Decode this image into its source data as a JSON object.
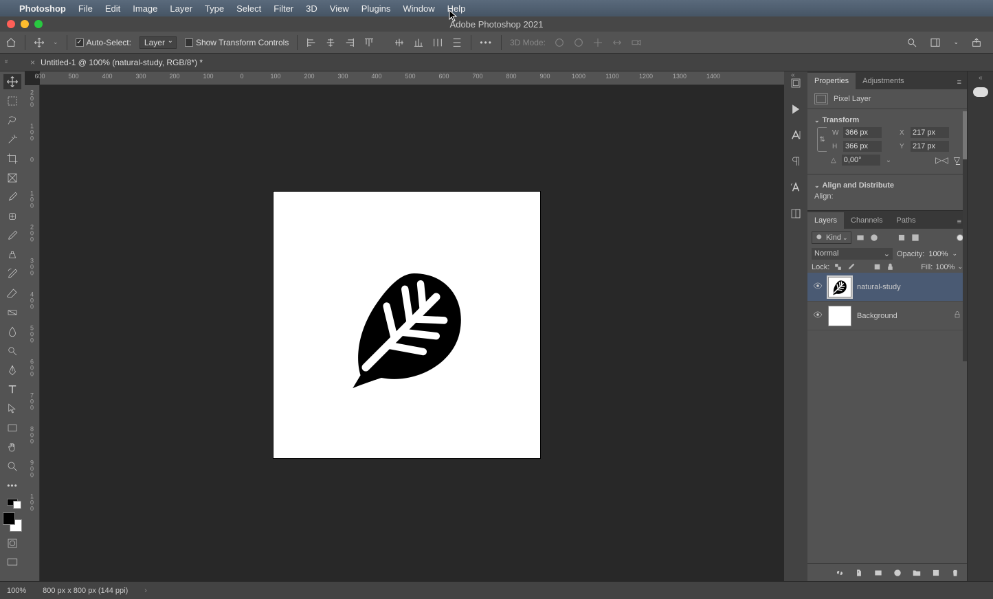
{
  "menu": {
    "apple": "",
    "app": "Photoshop",
    "items": [
      "File",
      "Edit",
      "Image",
      "Layer",
      "Type",
      "Select",
      "Filter",
      "3D",
      "View",
      "Plugins",
      "Window",
      "Help"
    ]
  },
  "window_title": "Adobe Photoshop 2021",
  "options": {
    "auto_select_label": "Auto-Select:",
    "auto_select_target": "Layer",
    "show_transform_label": "Show Transform Controls",
    "mode_3d_label": "3D Mode:"
  },
  "document_tab": "Untitled-1 @ 100% (natural-study, RGB/8*) *",
  "ruler_h": [
    "600",
    "500",
    "400",
    "300",
    "200",
    "100",
    "0",
    "100",
    "200",
    "300",
    "400",
    "500",
    "600",
    "700",
    "800",
    "900",
    "1000",
    "1100",
    "1200",
    "1300",
    "1400"
  ],
  "ruler_v": [
    {
      "n": "2",
      "s": "0",
      "s2": "0"
    },
    {
      "n": "1",
      "s": "0",
      "s2": "0"
    },
    {
      "n": "0",
      "s": "",
      "s2": ""
    },
    {
      "n": "1",
      "s": "0",
      "s2": "0"
    },
    {
      "n": "2",
      "s": "0",
      "s2": "0"
    },
    {
      "n": "3",
      "s": "0",
      "s2": "0"
    },
    {
      "n": "4",
      "s": "0",
      "s2": "0"
    },
    {
      "n": "5",
      "s": "0",
      "s2": "0"
    },
    {
      "n": "6",
      "s": "0",
      "s2": "0"
    },
    {
      "n": "7",
      "s": "0",
      "s2": "0"
    },
    {
      "n": "8",
      "s": "0",
      "s2": "0"
    },
    {
      "n": "9",
      "s": "0",
      "s2": "0"
    },
    {
      "n": "1",
      "s": "0",
      "s2": "0"
    }
  ],
  "properties": {
    "tab_properties": "Properties",
    "tab_adjustments": "Adjustments",
    "layer_type_label": "Pixel Layer",
    "transform_header": "Transform",
    "W_label": "W",
    "W_value": "366 px",
    "H_label": "H",
    "H_value": "366 px",
    "X_label": "X",
    "X_value": "217 px",
    "Y_label": "Y",
    "Y_value": "217 px",
    "angle_value": "0,00°",
    "align_header": "Align and Distribute",
    "align_label": "Align:"
  },
  "layers_panel": {
    "tab_layers": "Layers",
    "tab_channels": "Channels",
    "tab_paths": "Paths",
    "filter_kind_label": "Kind",
    "blend_mode": "Normal",
    "opacity_label": "Opacity:",
    "opacity_value": "100%",
    "lock_label": "Lock:",
    "fill_label": "Fill:",
    "fill_value": "100%",
    "layers": [
      {
        "name": "natural-study",
        "selected": true,
        "locked": false
      },
      {
        "name": "Background",
        "selected": false,
        "locked": true
      }
    ]
  },
  "status": {
    "zoom": "100%",
    "doc_info": "800 px x 800 px (144 ppi)"
  }
}
